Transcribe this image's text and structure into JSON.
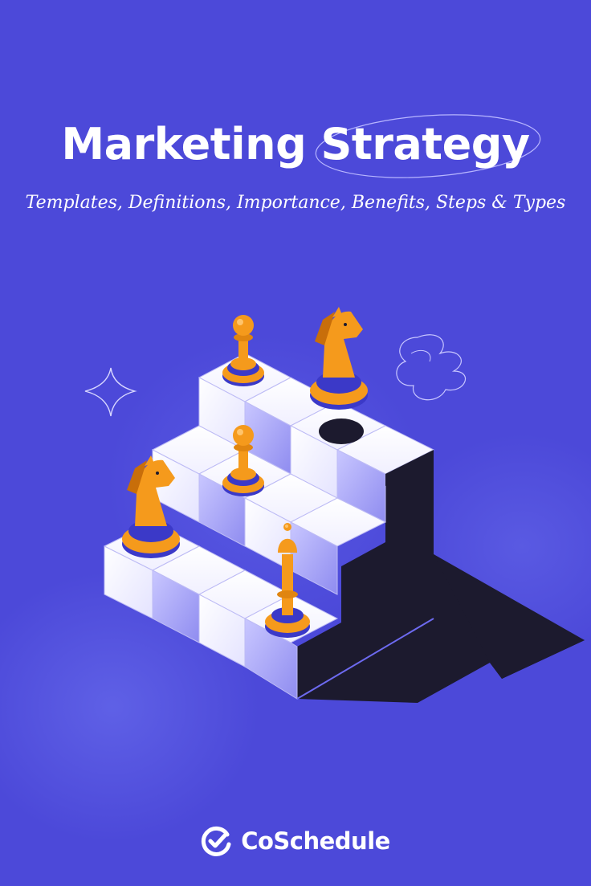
{
  "poster": {
    "title": "Marketing Strategy",
    "subtitle": "Templates, Definitions, Importance,  Benefits, Steps & Types",
    "brand": {
      "name": "CoSchedule",
      "icon": "coschedule-check-icon"
    }
  },
  "illustration": {
    "subject": "isometric staircase of cubes with chess pieces",
    "pieces": [
      "pawn-icon",
      "knight-icon",
      "pawn-icon",
      "knight-icon",
      "bishop-icon"
    ],
    "decorations": [
      "sparkle-icon",
      "scribble-icon"
    ]
  },
  "colors": {
    "background": "#4c49d9",
    "accent_orange": "#f59a1c",
    "accent_blue": "#3b39c8",
    "cube_white": "#ffffff",
    "shadow": "#1c1a2e"
  }
}
